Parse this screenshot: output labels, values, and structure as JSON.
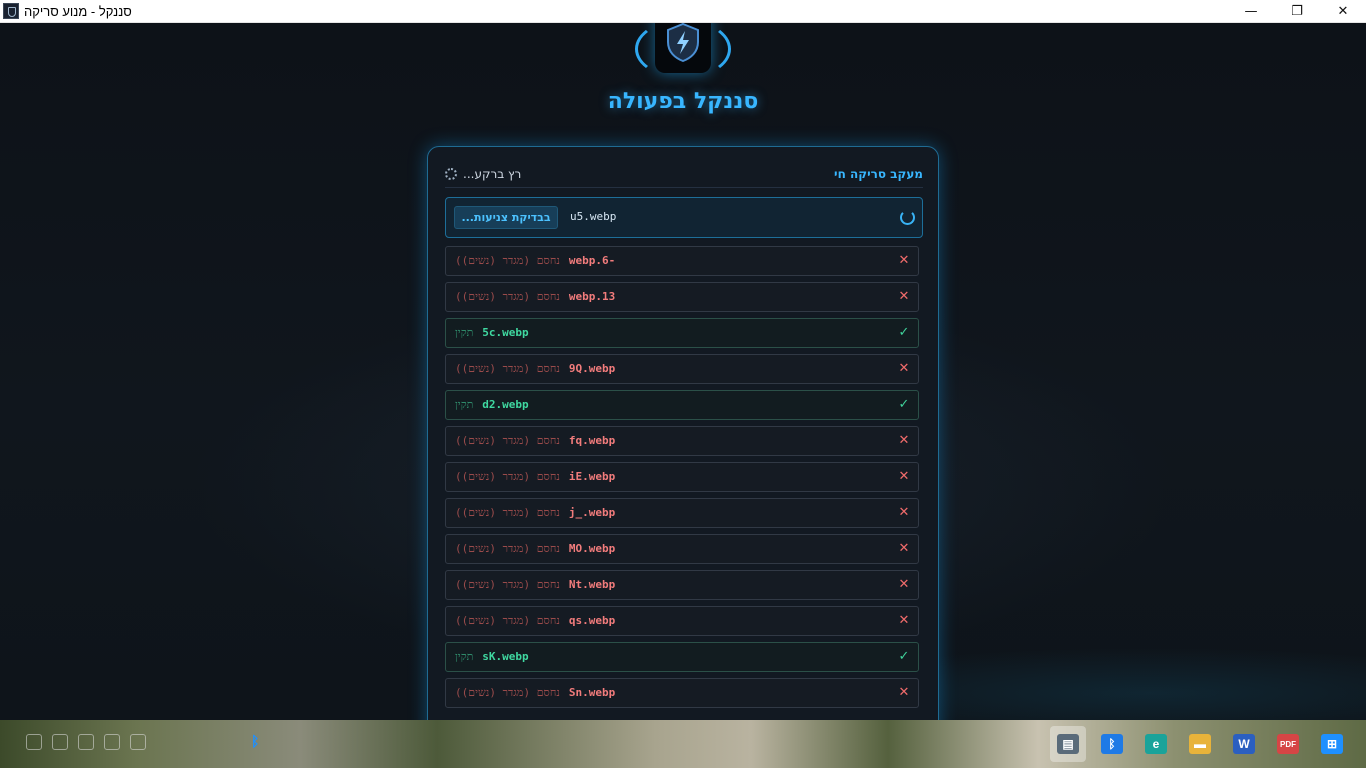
{
  "window": {
    "title": "סננקל - מנוע סריקה",
    "minimize_glyph": "—",
    "maximize_glyph": "❐",
    "close_glyph": "✕"
  },
  "app": {
    "heading": "סננקל בפעולה"
  },
  "panel": {
    "title": "מעקב סריקה חי",
    "background_status": "רץ ברקע..."
  },
  "current": {
    "file": "u5.webp",
    "action_label": "בבדיקת צניעות..."
  },
  "results": [
    {
      "file": "webp.6-",
      "status": "נחסם (מגדר (נשים))",
      "result": "blocked",
      "icon": "x-icon",
      "glyph": "✕"
    },
    {
      "file": "webp.13",
      "status": "נחסם (מגדר (נשים))",
      "result": "blocked",
      "icon": "x-icon",
      "glyph": "✕"
    },
    {
      "file": "5c.webp",
      "status": "תקין",
      "result": "ok",
      "icon": "check-icon",
      "glyph": "✓"
    },
    {
      "file": "9Q.webp",
      "status": "נחסם (מגדר (נשים))",
      "result": "blocked",
      "icon": "x-icon",
      "glyph": "✕"
    },
    {
      "file": "d2.webp",
      "status": "תקין",
      "result": "ok",
      "icon": "check-icon",
      "glyph": "✓"
    },
    {
      "file": "fq.webp",
      "status": "נחסם (מגדר (נשים))",
      "result": "blocked",
      "icon": "x-icon",
      "glyph": "✕"
    },
    {
      "file": "iE.webp",
      "status": "נחסם (מגדר (נשים))",
      "result": "blocked",
      "icon": "x-icon",
      "glyph": "✕"
    },
    {
      "file": "j_.webp",
      "status": "נחסם (מגדר (נשים))",
      "result": "blocked",
      "icon": "x-icon",
      "glyph": "✕"
    },
    {
      "file": "MO.webp",
      "status": "נחסם (מגדר (נשים))",
      "result": "blocked",
      "icon": "x-icon",
      "glyph": "✕"
    },
    {
      "file": "Nt.webp",
      "status": "נחסם (מגדר (נשים))",
      "result": "blocked",
      "icon": "x-icon",
      "glyph": "✕"
    },
    {
      "file": "qs.webp",
      "status": "נחסם (מגדר (נשים))",
      "result": "blocked",
      "icon": "x-icon",
      "glyph": "✕"
    },
    {
      "file": "sK.webp",
      "status": "תקין",
      "result": "ok",
      "icon": "check-icon",
      "glyph": "✓"
    },
    {
      "file": "Sn.webp",
      "status": "נחסם (מגדר (נשים))",
      "result": "blocked",
      "icon": "x-icon",
      "glyph": "✕"
    }
  ],
  "colors": {
    "accent": "#38b6ff",
    "blocked": "#f27c7c",
    "ok": "#3fd8a0",
    "background": "#0c1117"
  },
  "taskbar": {
    "icons": [
      {
        "name": "app-preview-icon",
        "glyph": "▤",
        "active": true
      },
      {
        "name": "bluetooth-icon",
        "glyph": "ᛒ",
        "active": false
      },
      {
        "name": "edge-icon",
        "glyph": "e",
        "active": false
      },
      {
        "name": "file-explorer-icon",
        "glyph": "▬",
        "active": false
      },
      {
        "name": "word-icon",
        "glyph": "W",
        "active": false
      },
      {
        "name": "pdf-icon",
        "glyph": "PDF",
        "active": false
      },
      {
        "name": "windows-start-icon",
        "glyph": "⊞",
        "active": false
      }
    ]
  }
}
